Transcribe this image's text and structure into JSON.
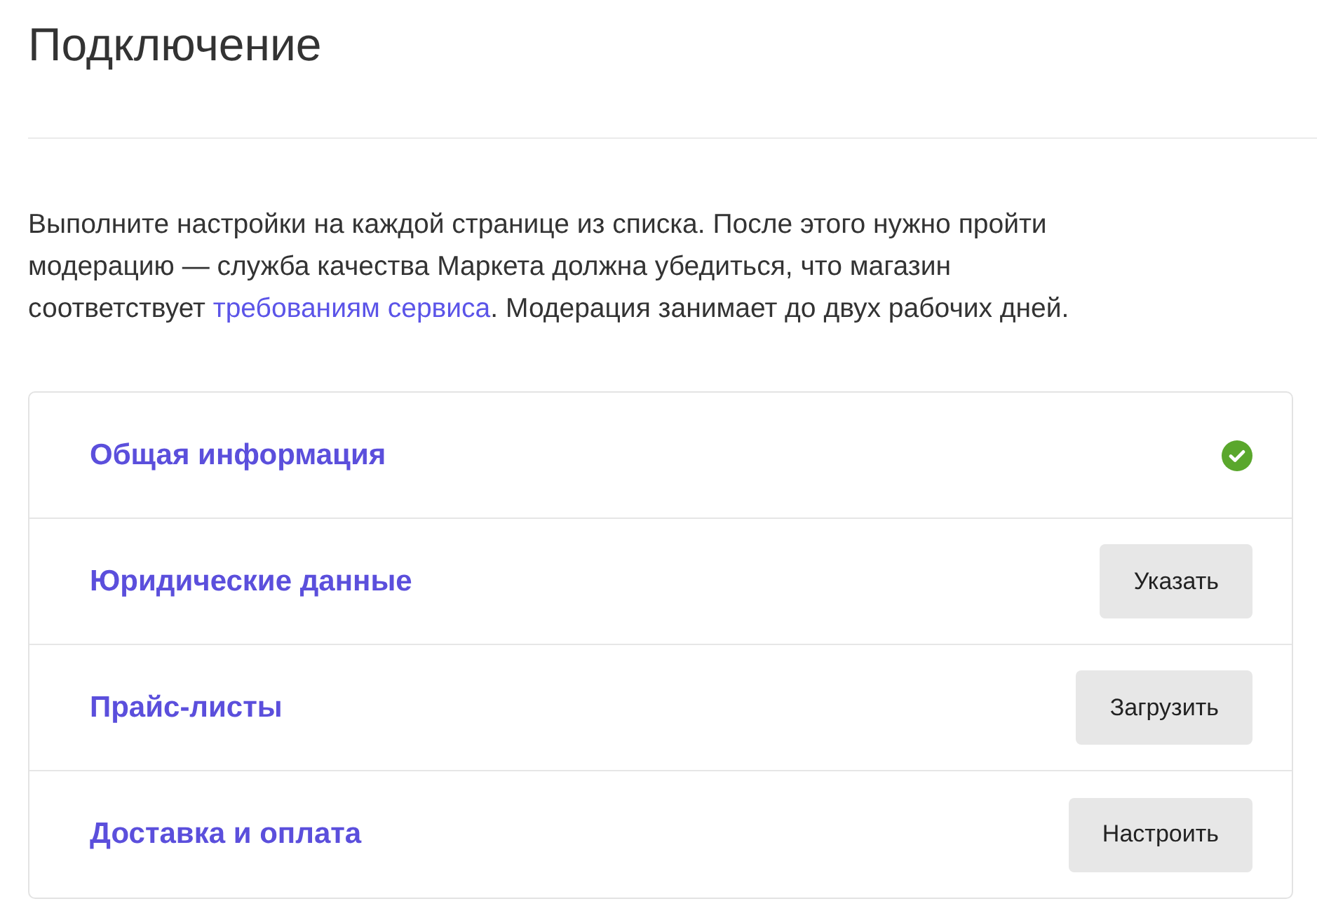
{
  "page": {
    "title": "Подключение"
  },
  "intro": {
    "lines": [
      [
        {
          "text": "Выполните настройки на каждой странице из списка. После этого нужно пройти",
          "link": false
        }
      ],
      [
        {
          "text": "модерацию — служба качества Маркета должна убедиться, что магазин",
          "link": false
        }
      ],
      [
        {
          "text": "соответствует ",
          "link": false
        },
        {
          "text": "требованиям сервиса",
          "link": true
        },
        {
          "text": ". Модерация занимает до двух рабочих дней.",
          "link": false
        }
      ]
    ]
  },
  "steps": [
    {
      "label": "Общая информация",
      "completed": true
    },
    {
      "label": "Юридические данные",
      "completed": false,
      "button": "Указать"
    },
    {
      "label": "Прайс-листы",
      "completed": false,
      "button": "Загрузить"
    },
    {
      "label": "Доставка и оплата",
      "completed": false,
      "button": "Настроить"
    }
  ]
}
